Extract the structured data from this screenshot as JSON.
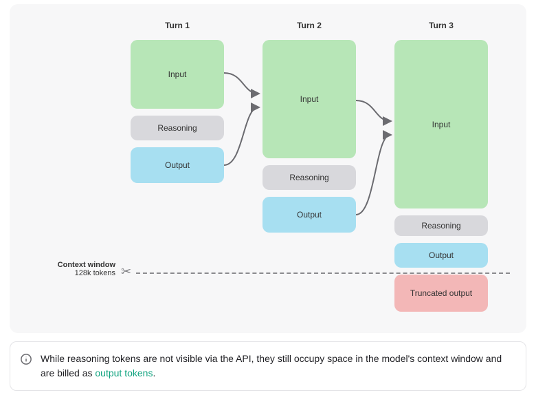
{
  "headings": {
    "t1": "Turn 1",
    "t2": "Turn 2",
    "t3": "Turn 3"
  },
  "blocks": {
    "input": "Input",
    "reasoning": "Reasoning",
    "output": "Output",
    "truncated": "Truncated output"
  },
  "context": {
    "label_line1": "Context window",
    "label_line2": "128k tokens"
  },
  "info": {
    "text_before": "While reasoning tokens are not visible via the API, they still occupy space in the model's context window and are billed as ",
    "link_text": "output tokens",
    "text_after": "."
  },
  "colors": {
    "input": "#b7e6b7",
    "reasoning": "#d8d8dc",
    "output": "#a7dff1",
    "truncated": "#f3b7b7",
    "card_bg": "#f7f7f8",
    "link": "#10a37f"
  }
}
